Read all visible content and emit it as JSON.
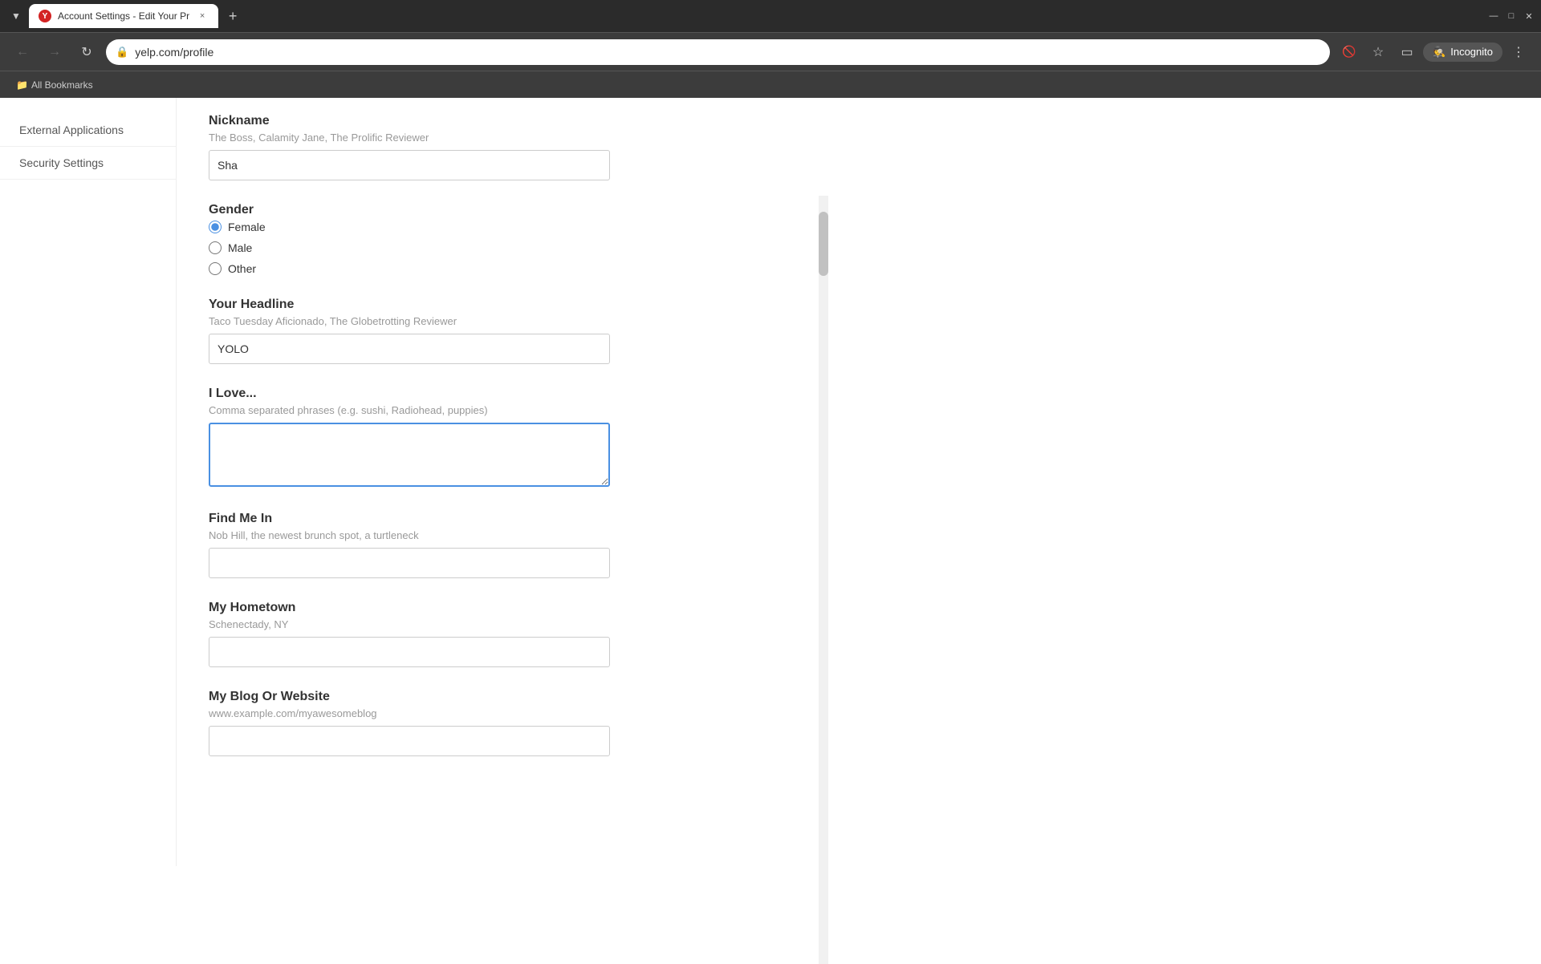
{
  "browser": {
    "tab": {
      "favicon_label": "Y",
      "title": "Account Settings - Edit Your Pr",
      "close_label": "×",
      "new_tab_label": "+"
    },
    "window_controls": {
      "minimize": "—",
      "maximize": "□",
      "close": "✕"
    },
    "nav": {
      "back_label": "←",
      "forward_label": "→",
      "refresh_label": "↻",
      "url": "yelp.com/profile",
      "eye_off_icon": "👁",
      "star_icon": "☆",
      "profile_icon": "□",
      "incognito_label": "Incognito",
      "more_icon": "⋮"
    },
    "bookmarks": {
      "all_bookmarks_label": "All Bookmarks"
    }
  },
  "sidebar": {
    "items": [
      {
        "id": "external-applications",
        "label": "External Applications"
      },
      {
        "id": "security-settings",
        "label": "Security Settings"
      }
    ]
  },
  "form": {
    "nickname": {
      "label": "Nickname",
      "hint": "The Boss, Calamity Jane, The Prolific Reviewer",
      "value": "Sha"
    },
    "gender": {
      "label": "Gender",
      "options": [
        {
          "value": "female",
          "label": "Female",
          "checked": true
        },
        {
          "value": "male",
          "label": "Male",
          "checked": false
        },
        {
          "value": "other",
          "label": "Other",
          "checked": false
        }
      ]
    },
    "headline": {
      "label": "Your Headline",
      "hint": "Taco Tuesday Aficionado, The Globetrotting Reviewer",
      "value": "YOLO"
    },
    "i_love": {
      "label": "I Love...",
      "hint": "Comma separated phrases (e.g. sushi, Radiohead, puppies)",
      "value": ""
    },
    "find_me_in": {
      "label": "Find Me In",
      "hint": "Nob Hill, the newest brunch spot, a turtleneck",
      "value": ""
    },
    "my_hometown": {
      "label": "My Hometown",
      "hint": "Schenectady, NY",
      "value": ""
    },
    "my_blog": {
      "label": "My Blog Or Website",
      "hint": "www.example.com/myawesomeblog",
      "value": ""
    }
  }
}
